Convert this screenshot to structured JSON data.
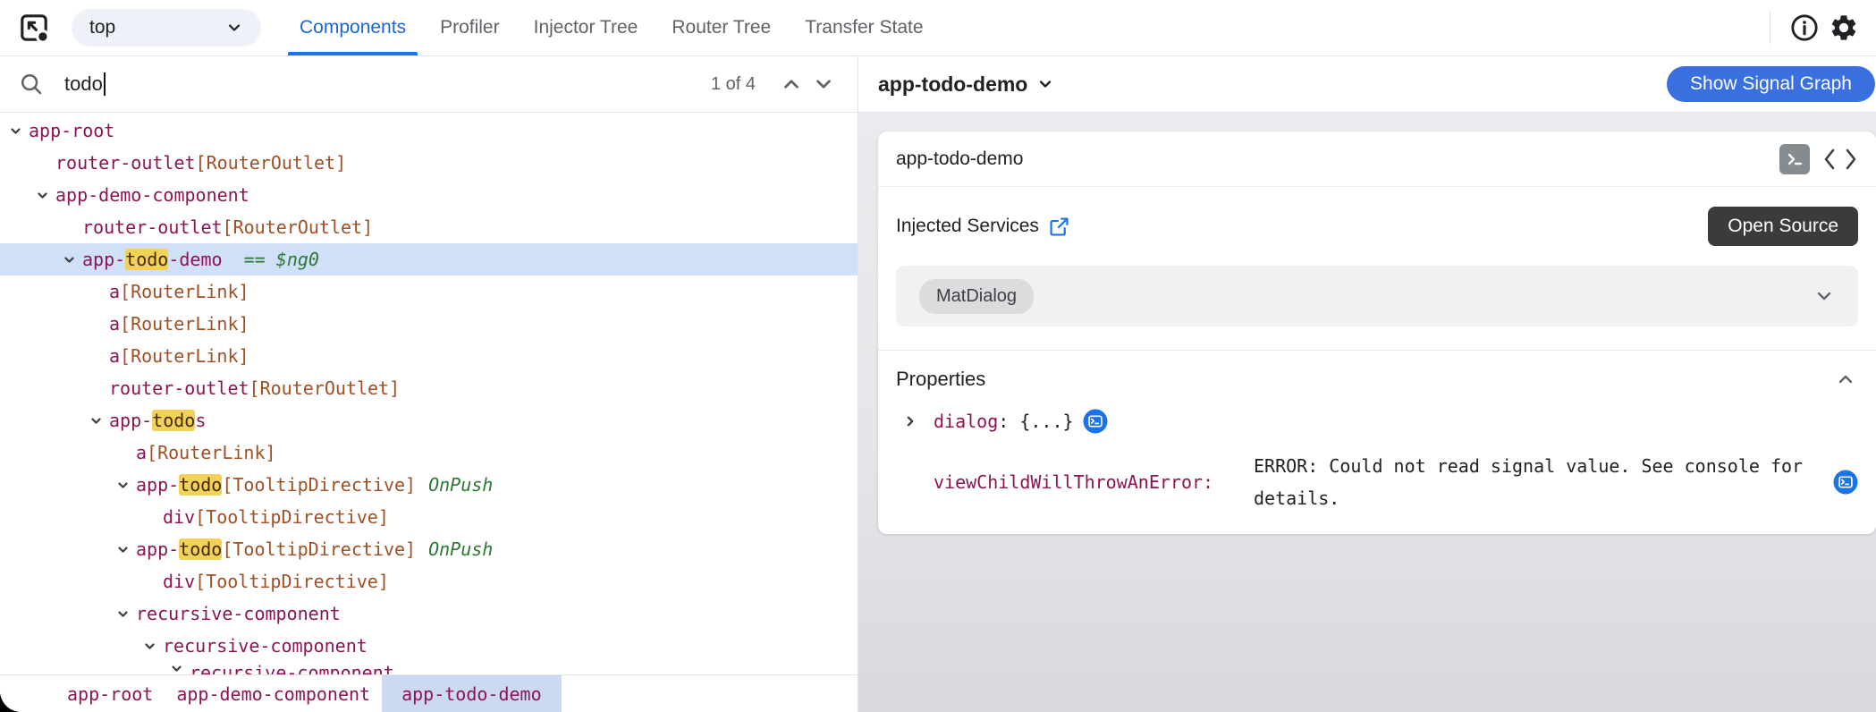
{
  "toolbar": {
    "frame_selector": {
      "value": "top"
    },
    "tabs": [
      {
        "label": "Components",
        "active": true
      },
      {
        "label": "Profiler",
        "active": false
      },
      {
        "label": "Injector Tree",
        "active": false
      },
      {
        "label": "Router Tree",
        "active": false
      },
      {
        "label": "Transfer State",
        "active": false
      }
    ],
    "icons": {
      "left": "inspect-element-icon",
      "right": [
        "info-icon",
        "settings-gear-icon"
      ]
    }
  },
  "search": {
    "value": "todo",
    "result_count": "1 of 4"
  },
  "tree": {
    "rows": [
      {
        "level": 0,
        "caret": true,
        "parts": [
          [
            "app-root",
            "el"
          ]
        ]
      },
      {
        "level": 1,
        "caret": false,
        "parts": [
          [
            "router-outlet",
            "el"
          ],
          [
            "[RouterOutlet]",
            "dir"
          ]
        ]
      },
      {
        "level": 1,
        "caret": true,
        "parts": [
          [
            "app-demo-component",
            "el"
          ]
        ]
      },
      {
        "level": 2,
        "caret": false,
        "parts": [
          [
            "router-outlet",
            "el"
          ],
          [
            "[RouterOutlet]",
            "dir"
          ]
        ]
      },
      {
        "level": 2,
        "caret": true,
        "selected": true,
        "parts": [
          [
            "app-",
            "el"
          ],
          [
            "todo",
            "hl"
          ],
          [
            "-demo",
            "el"
          ],
          [
            "  == ",
            "ref"
          ],
          [
            "$ng0",
            "refi"
          ]
        ]
      },
      {
        "level": 3,
        "caret": false,
        "parts": [
          [
            "a",
            "el"
          ],
          [
            "[RouterLink]",
            "dir"
          ]
        ]
      },
      {
        "level": 3,
        "caret": false,
        "parts": [
          [
            "a",
            "el"
          ],
          [
            "[RouterLink]",
            "dir"
          ]
        ]
      },
      {
        "level": 3,
        "caret": false,
        "parts": [
          [
            "a",
            "el"
          ],
          [
            "[RouterLink]",
            "dir"
          ]
        ]
      },
      {
        "level": 3,
        "caret": false,
        "parts": [
          [
            "router-outlet",
            "el"
          ],
          [
            "[RouterOutlet]",
            "dir"
          ]
        ]
      },
      {
        "level": 3,
        "caret": true,
        "parts": [
          [
            "app-",
            "el"
          ],
          [
            "todo",
            "hl"
          ],
          [
            "s",
            "el"
          ]
        ]
      },
      {
        "level": 4,
        "caret": false,
        "parts": [
          [
            "a",
            "el"
          ],
          [
            "[RouterLink]",
            "dir"
          ]
        ]
      },
      {
        "level": 4,
        "caret": true,
        "parts": [
          [
            "app-",
            "el"
          ],
          [
            "todo",
            "hl"
          ],
          [
            "[TooltipDirective]",
            "dir"
          ],
          [
            "OnPush",
            "onpush"
          ]
        ]
      },
      {
        "level": 5,
        "caret": false,
        "parts": [
          [
            "div",
            "el"
          ],
          [
            "[TooltipDirective]",
            "dir"
          ]
        ]
      },
      {
        "level": 4,
        "caret": true,
        "parts": [
          [
            "app-",
            "el"
          ],
          [
            "todo",
            "hl"
          ],
          [
            "[TooltipDirective]",
            "dir"
          ],
          [
            "OnPush",
            "onpush"
          ]
        ]
      },
      {
        "level": 5,
        "caret": false,
        "parts": [
          [
            "div",
            "el"
          ],
          [
            "[TooltipDirective]",
            "dir"
          ]
        ]
      },
      {
        "level": 4,
        "caret": true,
        "parts": [
          [
            "recursive-component",
            "el"
          ]
        ]
      },
      {
        "level": 5,
        "caret": true,
        "parts": [
          [
            "recursive-component",
            "el"
          ]
        ]
      },
      {
        "level": 6,
        "caret": true,
        "clipped": true,
        "parts": [
          [
            "recursive-component",
            "el"
          ]
        ]
      }
    ]
  },
  "breadcrumbs": [
    {
      "label": "app-root",
      "selected": false
    },
    {
      "label": "app-demo-component",
      "selected": false
    },
    {
      "label": "app-todo-demo",
      "selected": true
    }
  ],
  "details": {
    "title": "app-todo-demo",
    "show_signal_graph": "Show Signal Graph",
    "card": {
      "title": "app-todo-demo",
      "header_icons": [
        "terminal-icon",
        "code-icon"
      ],
      "injected_services": {
        "label": "Injected Services",
        "external_link_icon": "open-in-new-icon",
        "open_source_button": "Open Source",
        "services": [
          "MatDialog"
        ]
      },
      "properties": {
        "label": "Properties",
        "rows": [
          {
            "key": "dialog",
            "value": ": {...}",
            "expandable": true,
            "wrap": false,
            "console_icon": true
          },
          {
            "key": "viewChildWillThrowAnError:",
            "value": "ERROR: Could not read signal value. See console for details.",
            "expandable": false,
            "wrap": true,
            "console_icon": true
          }
        ]
      }
    }
  },
  "colors": {
    "accent_blue": "#1a73e8",
    "active_tab": "#1967d2",
    "element_name": "#8c1455",
    "directive_name": "#a05023",
    "green_badge": "#2d7832",
    "search_highlight": "#f1d158",
    "selected_row": "#cfe0f8",
    "signal_button": "#3a6fe0",
    "open_source_button": "#3a3b3d"
  }
}
